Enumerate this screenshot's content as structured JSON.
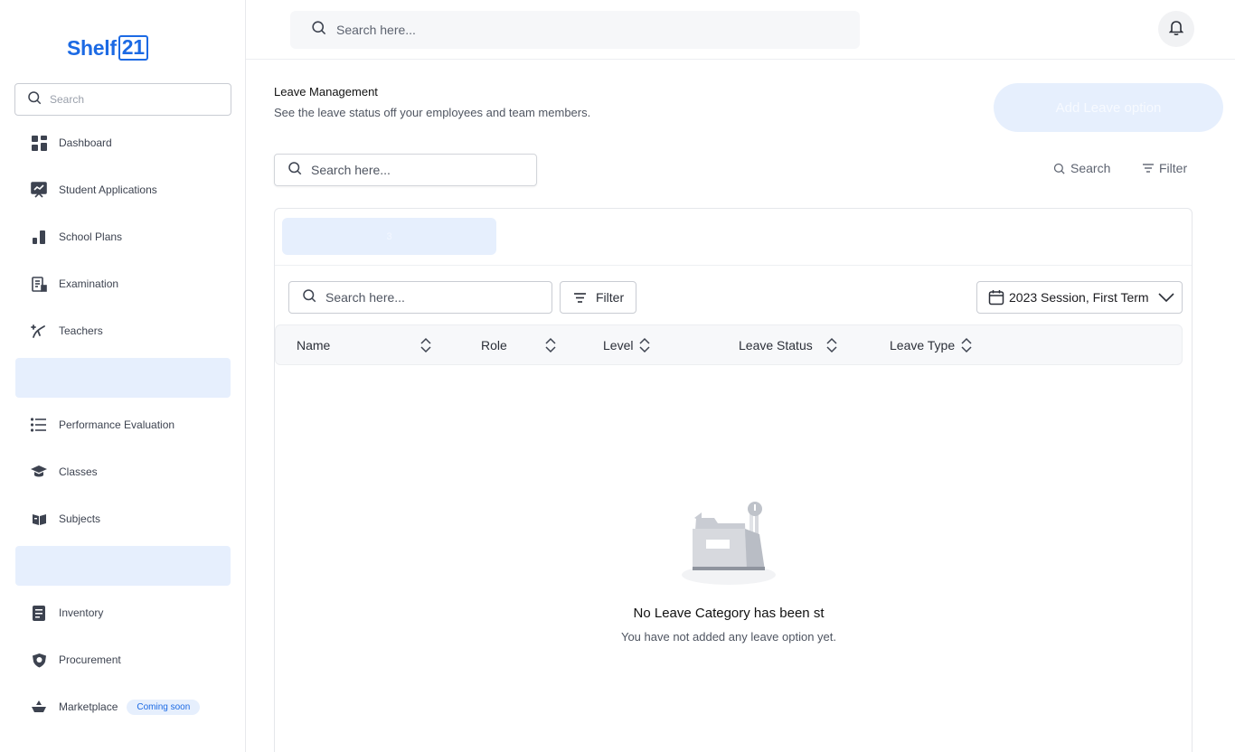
{
  "brand": {
    "name": "Shelf",
    "number": "21"
  },
  "sidebar": {
    "search_placeholder": "Search",
    "items": [
      {
        "label": "Dashboard",
        "icon": "dashboard-icon"
      },
      {
        "label": "Student Applications",
        "icon": "chart-board-icon"
      },
      {
        "label": "School Plans",
        "icon": "bar-chart-icon"
      },
      {
        "label": "Examination",
        "icon": "exam-icon"
      },
      {
        "label": "Teachers",
        "icon": "teacher-icon"
      },
      {
        "label": "Performance Evaluation",
        "icon": "list-icon"
      },
      {
        "label": "Classes",
        "icon": "graduation-cap-icon"
      },
      {
        "label": "Subjects",
        "icon": "book-icon"
      },
      {
        "label": "Inventory",
        "icon": "document-icon"
      },
      {
        "label": "Procurement",
        "icon": "shield-icon"
      },
      {
        "label": "Marketplace",
        "icon": "ship-icon",
        "badge": "Coming soon"
      }
    ]
  },
  "topbar": {
    "search_placeholder": "Search here..."
  },
  "page": {
    "title": "Leave Management",
    "subtitle": "See the leave status off your employees and team members.",
    "add_button": "Add Leave option",
    "search_placeholder": "Search here...",
    "search_link": "Search",
    "filter_link": "Filter"
  },
  "card": {
    "tab_label": "3",
    "search_placeholder": "Search here...",
    "filter_label": "Filter",
    "session_label": "2023 Session, First Term",
    "columns": [
      "Name",
      "Role",
      "Level",
      "Leave Status",
      "Leave Type"
    ],
    "empty_title": "No Leave Category has been st",
    "empty_subtitle": "You have not added any leave option yet."
  },
  "colors": {
    "accent": "#1c6ae4",
    "accent_light": "#e6effd",
    "border": "#c9ccd3"
  }
}
